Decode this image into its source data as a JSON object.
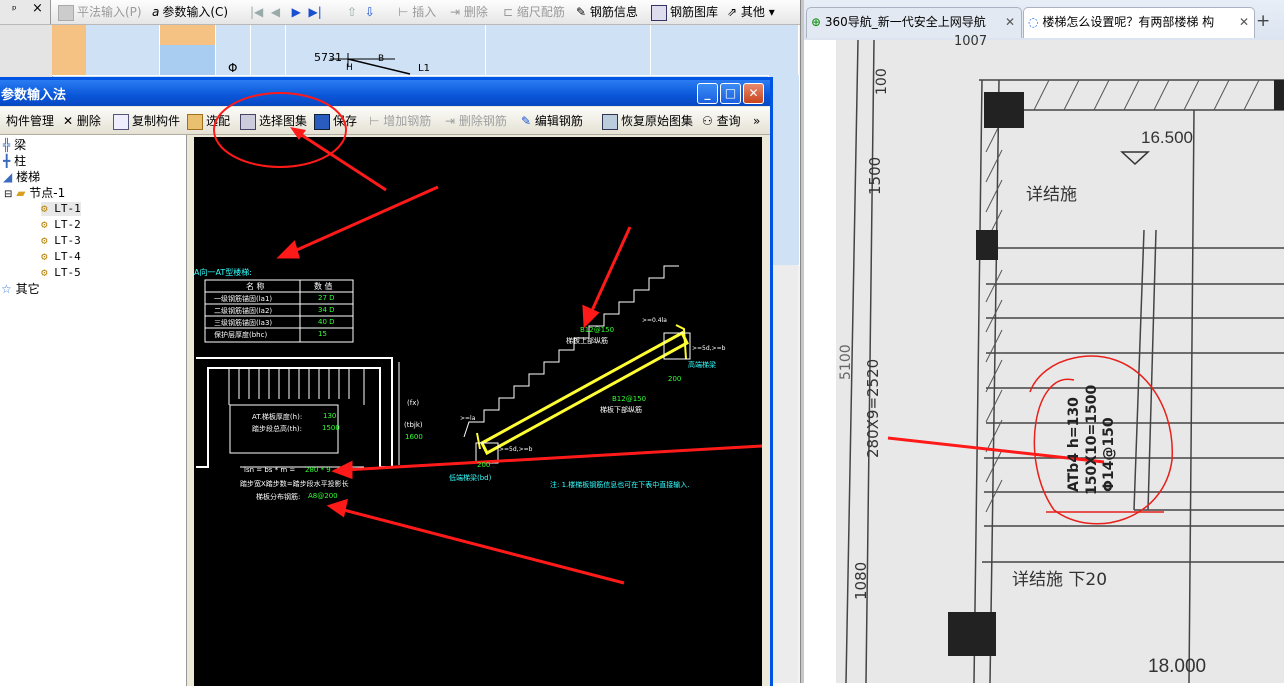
{
  "app": {
    "top_toolbar": {
      "items": [
        {
          "label": "平法输入(P)",
          "enabled": false
        },
        {
          "label": "参数输入(C)",
          "enabled": true
        },
        {
          "label": "插入",
          "enabled": false
        },
        {
          "label": "删除",
          "enabled": false
        },
        {
          "label": "缩尺配筋",
          "enabled": false
        },
        {
          "label": "钢筋信息",
          "enabled": true
        },
        {
          "label": "钢筋图库",
          "enabled": true
        },
        {
          "label": "其他",
          "enabled": true
        }
      ],
      "panel_pin": "ᵖ",
      "panel_close": "×"
    },
    "grid": {
      "symbol": "Φ",
      "sketch_number": "5731",
      "sketch_b": "B",
      "sketch_h": "H",
      "sketch_l1": "L1"
    }
  },
  "dialog": {
    "title": "参数输入法",
    "toolbar": [
      {
        "label": "构件管理",
        "enabled": true
      },
      {
        "label": "删除",
        "enabled": true
      },
      {
        "label": "复制构件",
        "enabled": true
      },
      {
        "label": "选配",
        "enabled": true
      },
      {
        "label": "选择图集",
        "enabled": true
      },
      {
        "label": "保存",
        "enabled": true
      },
      {
        "label": "增加钢筋",
        "enabled": false
      },
      {
        "label": "删除钢筋",
        "enabled": false
      },
      {
        "label": "编辑钢筋",
        "enabled": true
      },
      {
        "label": "恢复原始图集",
        "enabled": true
      },
      {
        "label": "查询",
        "enabled": true
      }
    ],
    "overflow": "»",
    "tree": {
      "items": [
        {
          "label": "梁"
        },
        {
          "label": "柱"
        },
        {
          "label": "楼梯"
        },
        {
          "label": "节点-1"
        },
        {
          "label": "LT-1"
        },
        {
          "label": "LT-2"
        },
        {
          "label": "LT-3"
        },
        {
          "label": "LT-4"
        },
        {
          "label": "LT-5"
        },
        {
          "label": "其它"
        }
      ]
    },
    "drawing": {
      "heading": "A向一AT型楼梯:",
      "table_headers": [
        "名 称",
        "数 值"
      ],
      "table_rows": [
        [
          "一级钢筋锚固(la1)",
          "27 D"
        ],
        [
          "二级钢筋锚固(la2)",
          "34 D"
        ],
        [
          "三级钢筋锚固(la3)",
          "40 D"
        ],
        [
          "保护层厚度(bhc)",
          "15"
        ]
      ],
      "plan_line1": "AT.梯板厚度(h):",
      "plan_val1": "130",
      "plan_line2": "踏步段总高(th):",
      "plan_val2": "1500",
      "plan_fx": "(fx)",
      "plan_tbjk": "(tbjk)",
      "plan_tbjk_val": "1600",
      "lsn_label": "lsn = bs * m =",
      "lsn_val": "280 * 9",
      "step_text": "踏步宽X踏步数=踏步段水平投影长",
      "dist_text": "梯板分布钢筋:",
      "dist_val": "A8@200",
      "upper_rebar": "B12@150",
      "upper_label": "梯板上部纵筋",
      "lower_rebar": "B12@150",
      "lower_label": "梯板下部纵筋",
      "high_end": "高端梯梁",
      "low_end": "低端梯梁(bd)",
      "dim_200a": "200",
      "dim_200b": "200",
      "dim_5d_a": ">=5d,>=b",
      "dim_5d_b": ">=5d,>=b",
      "dim_la": ">=la",
      "dim_04": ">=0.4la",
      "note": "注: 1.楼梯板钢筋信息也可在下表中直接输入."
    }
  },
  "browser": {
    "tabs": [
      {
        "label": "360导航_新一代安全上网导航",
        "active": false
      },
      {
        "label": "楼梯怎么设置呢？有两部楼梯 构",
        "active": true
      }
    ],
    "new_tab": "+",
    "photo": {
      "elev_top": "16.500",
      "elev_bottom": "18.000",
      "detail_top": "详结施",
      "detail_bottom": "详结施 下20",
      "dim_1500": "1500",
      "dim_100": "100",
      "dim_280x9": "280X9=2520",
      "dim_1080": "1080",
      "dim_5100": "5100",
      "annot_atb": "ATb4 h=130",
      "annot_150": "150X10=1500",
      "annot_rebar": "Φ14@150",
      "annot_1007": "1007"
    }
  }
}
